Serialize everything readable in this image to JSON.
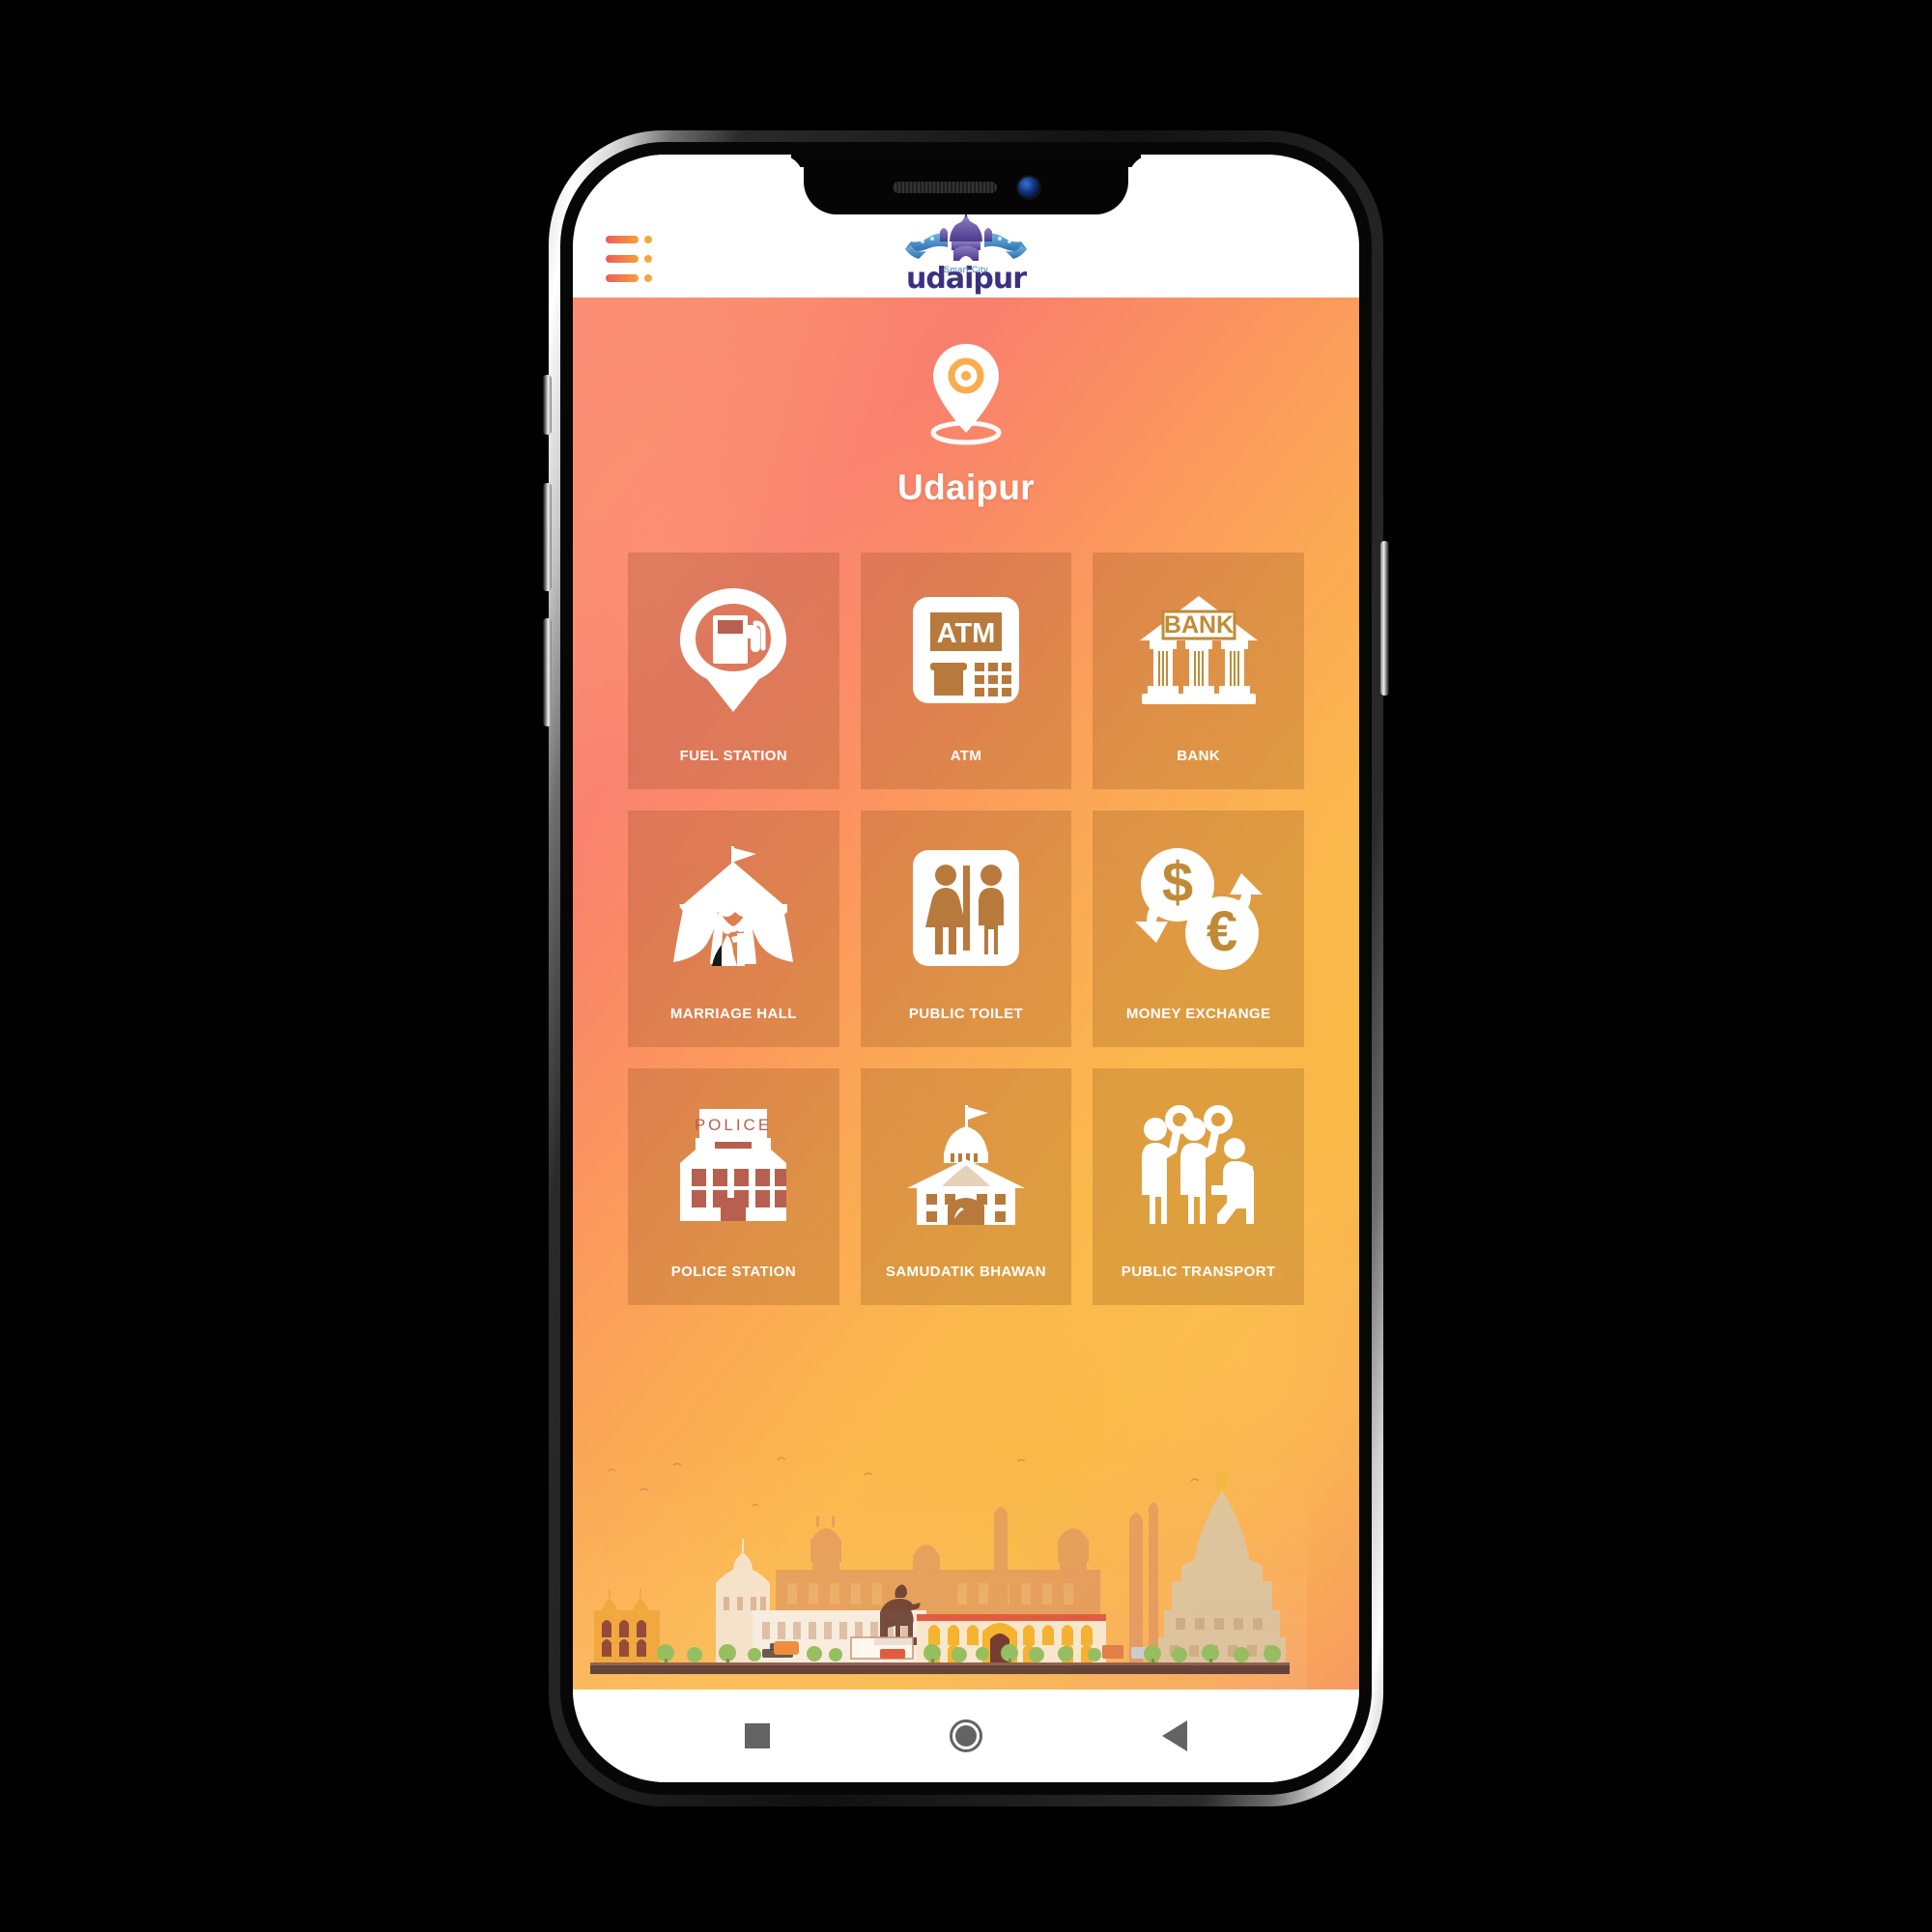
{
  "app": {
    "header": {
      "menu_icon": "hamburger-menu-icon",
      "logo_tagline": "Smart City",
      "logo_wordmark": "udaipur",
      "logo_emblem": "palace-emblem-icon"
    },
    "hero": {
      "pin_icon": "location-pin-icon",
      "city_name": "Udaipur"
    },
    "tiles": [
      {
        "label": "FUEL STATION",
        "icon": "fuel-pump-pin-icon",
        "tint": "#b8604f"
      },
      {
        "label": "ATM",
        "icon": "atm-machine-icon",
        "tint": "#b87a3c"
      },
      {
        "label": "BANK",
        "icon": "bank-building-icon",
        "tint": "#c08b36"
      },
      {
        "label": "MARRIAGE HALL",
        "icon": "wedding-tent-icon",
        "tint": "#b8604f"
      },
      {
        "label": "PUBLIC TOILET",
        "icon": "restroom-sign-icon",
        "tint": "#b87a3c"
      },
      {
        "label": "MONEY EXCHANGE",
        "icon": "currency-exchange-icon",
        "tint": "#c08b36"
      },
      {
        "label": "POLICE STATION",
        "icon": "police-station-icon",
        "tint": "#b8604f"
      },
      {
        "label": "SAMUDATIK BHAWAN",
        "icon": "government-dome-icon",
        "tint": "#b87a3c"
      },
      {
        "label": "PUBLIC TRANSPORT",
        "icon": "commuters-icon",
        "tint": "#c08b36"
      }
    ],
    "cityscape": {
      "name": "udaipur-skyline-illustration"
    },
    "navbar": {
      "recents": "recents-square-icon",
      "home": "home-circle-icon",
      "back": "back-triangle-icon"
    },
    "colors": {
      "gradient_start": "#fa8c74",
      "gradient_mid": "#fba955",
      "gradient_end": "#f79a62",
      "accent_orange": "#f4a83c",
      "accent_red": "#f05a5a",
      "logo_purple": "#3b3183",
      "logo_blue": "#2f7fb5",
      "nav_icon_gray": "#636363"
    }
  },
  "device": {
    "notch": {
      "speaker": "speaker-grille",
      "camera": "front-camera-lens"
    },
    "buttons": {
      "mute": "mute-switch",
      "volume_up": "volume-up-button",
      "volume_down": "volume-down-button",
      "power": "power-button"
    }
  }
}
